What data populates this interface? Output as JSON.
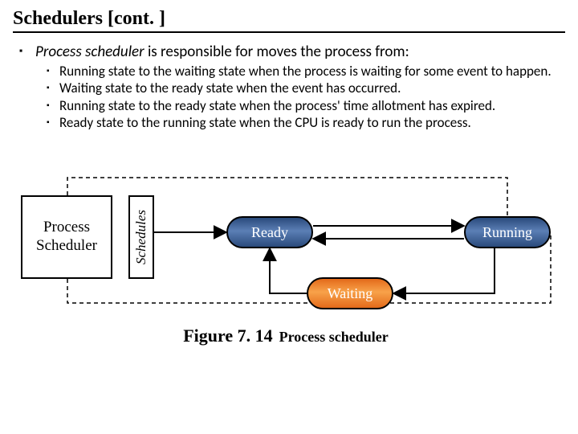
{
  "title": "Schedulers [cont. ]",
  "lead_term": "Process scheduler",
  "lead_rest": " is responsible for moves the process from:",
  "bullets": [
    " Running state to the waiting state when the process is waiting for some event to happen.",
    " Waiting state to the ready state when the event has occurred.",
    " Running state to the ready state when the process' time allotment has expired.",
    "Ready state to the running state when the CPU is ready to run the process."
  ],
  "diagram": {
    "process_scheduler": "Process\nScheduler",
    "schedules_label": "Schedules",
    "states": {
      "ready": "Ready",
      "running": "Running",
      "waiting": "Waiting"
    }
  },
  "figure": {
    "number": "Figure 7. 14",
    "caption": "Process scheduler"
  }
}
